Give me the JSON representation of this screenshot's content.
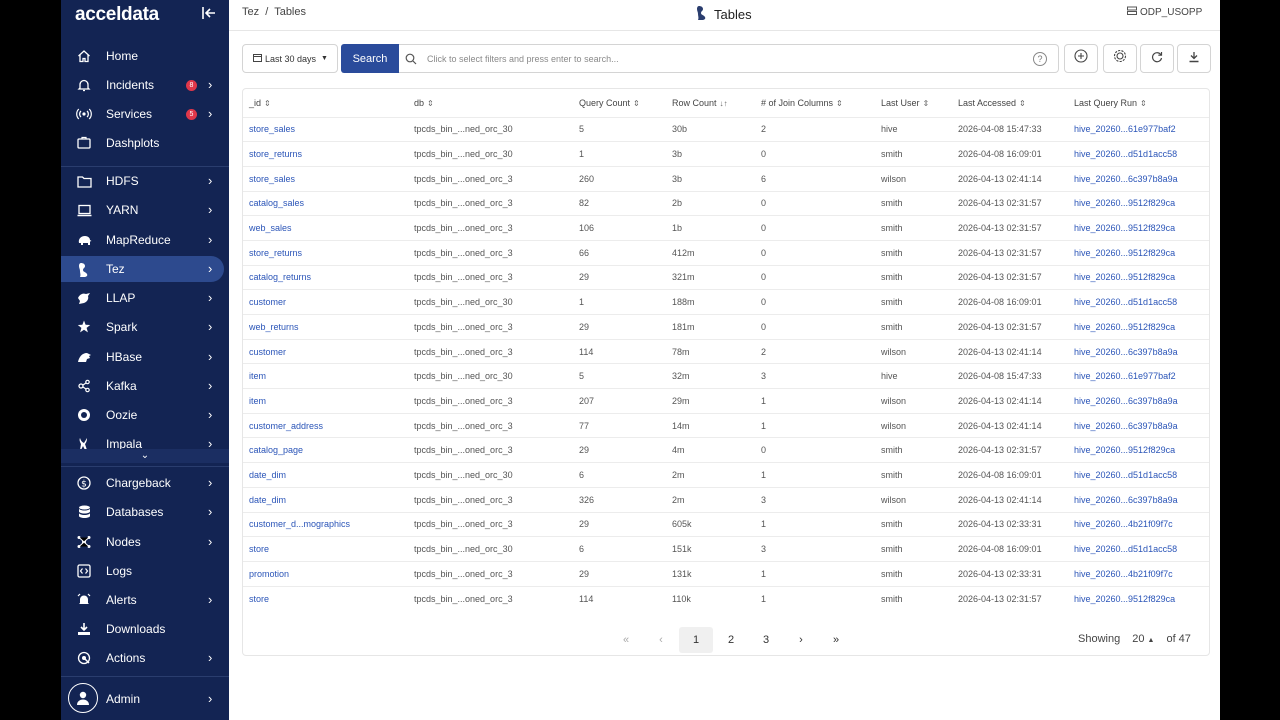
{
  "app": {
    "logo": "acceldata",
    "collapse_icon": "collapse-left-icon"
  },
  "sidebar": {
    "items": [
      {
        "label": "Home",
        "icon": "home-icon",
        "chevron": false
      },
      {
        "label": "Incidents",
        "icon": "bell-icon",
        "chevron": true,
        "badge": "8"
      },
      {
        "label": "Services",
        "icon": "broadcast-icon",
        "chevron": true,
        "badge": "5"
      },
      {
        "label": "Dashplots",
        "icon": "dashboard-icon",
        "chevron": false
      },
      {
        "label": "HDFS",
        "icon": "folder-icon",
        "chevron": true
      },
      {
        "label": "YARN",
        "icon": "laptop-icon",
        "chevron": true
      },
      {
        "label": "MapReduce",
        "icon": "elephant-icon",
        "chevron": true
      },
      {
        "label": "Tez",
        "icon": "tez-icon",
        "chevron": true,
        "active": true
      },
      {
        "label": "LLAP",
        "icon": "llap-icon",
        "chevron": true
      },
      {
        "label": "Spark",
        "icon": "spark-icon",
        "chevron": true
      },
      {
        "label": "HBase",
        "icon": "hbase-icon",
        "chevron": true
      },
      {
        "label": "Kafka",
        "icon": "kafka-icon",
        "chevron": true
      },
      {
        "label": "Oozie",
        "icon": "oozie-icon",
        "chevron": true
      },
      {
        "label": "Impala",
        "icon": "impala-icon",
        "chevron": true
      },
      {
        "label": "Chargeback",
        "icon": "dollar-icon",
        "chevron": true
      },
      {
        "label": "Databases",
        "icon": "database-icon",
        "chevron": true
      },
      {
        "label": "Nodes",
        "icon": "nodes-icon",
        "chevron": true
      },
      {
        "label": "Logs",
        "icon": "code-icon",
        "chevron": false
      },
      {
        "label": "Alerts",
        "icon": "alarm-icon",
        "chevron": true
      },
      {
        "label": "Downloads",
        "icon": "download-icon",
        "chevron": false
      },
      {
        "label": "Actions",
        "icon": "target-icon",
        "chevron": true
      }
    ],
    "scroll_more_icon": "chevron-down-icon",
    "user": {
      "label": "Admin",
      "icon": "user-icon"
    }
  },
  "header": {
    "breadcrumb": "Tez  /  Tables",
    "title": "Tables",
    "cluster": "ODP_USOPP"
  },
  "toolbar": {
    "date_range": "Last 30 days",
    "search_label": "Search",
    "search_placeholder": "Click to select filters and press enter to search..."
  },
  "table": {
    "columns": [
      "_id",
      "db",
      "Query Count",
      "Row Count",
      "# of Join Columns",
      "Last User",
      "Last Accessed",
      "Last Query Run"
    ],
    "rows": [
      [
        "store_sales",
        "tpcds_bin_...ned_orc_30",
        "5",
        "30b",
        "2",
        "hive",
        "2026-04-08 15:47:33",
        "hive_20260...61e977baf2"
      ],
      [
        "store_returns",
        "tpcds_bin_...ned_orc_30",
        "1",
        "3b",
        "0",
        "smith",
        "2026-04-08 16:09:01",
        "hive_20260...d51d1acc58"
      ],
      [
        "store_sales",
        "tpcds_bin_...oned_orc_3",
        "260",
        "3b",
        "6",
        "wilson",
        "2026-04-13 02:41:14",
        "hive_20260...6c397b8a9a"
      ],
      [
        "catalog_sales",
        "tpcds_bin_...oned_orc_3",
        "82",
        "2b",
        "0",
        "smith",
        "2026-04-13 02:31:57",
        "hive_20260...9512f829ca"
      ],
      [
        "web_sales",
        "tpcds_bin_...oned_orc_3",
        "106",
        "1b",
        "0",
        "smith",
        "2026-04-13 02:31:57",
        "hive_20260...9512f829ca"
      ],
      [
        "store_returns",
        "tpcds_bin_...oned_orc_3",
        "66",
        "412m",
        "0",
        "smith",
        "2026-04-13 02:31:57",
        "hive_20260...9512f829ca"
      ],
      [
        "catalog_returns",
        "tpcds_bin_...oned_orc_3",
        "29",
        "321m",
        "0",
        "smith",
        "2026-04-13 02:31:57",
        "hive_20260...9512f829ca"
      ],
      [
        "customer",
        "tpcds_bin_...ned_orc_30",
        "1",
        "188m",
        "0",
        "smith",
        "2026-04-08 16:09:01",
        "hive_20260...d51d1acc58"
      ],
      [
        "web_returns",
        "tpcds_bin_...oned_orc_3",
        "29",
        "181m",
        "0",
        "smith",
        "2026-04-13 02:31:57",
        "hive_20260...9512f829ca"
      ],
      [
        "customer",
        "tpcds_bin_...oned_orc_3",
        "114",
        "78m",
        "2",
        "wilson",
        "2026-04-13 02:41:14",
        "hive_20260...6c397b8a9a"
      ],
      [
        "item",
        "tpcds_bin_...ned_orc_30",
        "5",
        "32m",
        "3",
        "hive",
        "2026-04-08 15:47:33",
        "hive_20260...61e977baf2"
      ],
      [
        "item",
        "tpcds_bin_...oned_orc_3",
        "207",
        "29m",
        "1",
        "wilson",
        "2026-04-13 02:41:14",
        "hive_20260...6c397b8a9a"
      ],
      [
        "customer_address",
        "tpcds_bin_...oned_orc_3",
        "77",
        "14m",
        "1",
        "wilson",
        "2026-04-13 02:41:14",
        "hive_20260...6c397b8a9a"
      ],
      [
        "catalog_page",
        "tpcds_bin_...oned_orc_3",
        "29",
        "4m",
        "0",
        "smith",
        "2026-04-13 02:31:57",
        "hive_20260...9512f829ca"
      ],
      [
        "date_dim",
        "tpcds_bin_...ned_orc_30",
        "6",
        "2m",
        "1",
        "smith",
        "2026-04-08 16:09:01",
        "hive_20260...d51d1acc58"
      ],
      [
        "date_dim",
        "tpcds_bin_...oned_orc_3",
        "326",
        "2m",
        "3",
        "wilson",
        "2026-04-13 02:41:14",
        "hive_20260...6c397b8a9a"
      ],
      [
        "customer_d...mographics",
        "tpcds_bin_...oned_orc_3",
        "29",
        "605k",
        "1",
        "smith",
        "2026-04-13 02:33:31",
        "hive_20260...4b21f09f7c"
      ],
      [
        "store",
        "tpcds_bin_...ned_orc_30",
        "6",
        "151k",
        "3",
        "smith",
        "2026-04-08 16:09:01",
        "hive_20260...d51d1acc58"
      ],
      [
        "promotion",
        "tpcds_bin_...oned_orc_3",
        "29",
        "131k",
        "1",
        "smith",
        "2026-04-13 02:33:31",
        "hive_20260...4b21f09f7c"
      ],
      [
        "store",
        "tpcds_bin_...oned_orc_3",
        "114",
        "110k",
        "1",
        "smith",
        "2026-04-13 02:31:57",
        "hive_20260...9512f829ca"
      ]
    ]
  },
  "pagination": {
    "first": "«",
    "prev": "‹",
    "pages": [
      "1",
      "2",
      "3"
    ],
    "current": "1",
    "next": "›",
    "last": "»",
    "showing_label": "Showing",
    "page_size": "20",
    "total": "of 47"
  },
  "colors": {
    "sidebar_bg": "#132453",
    "active_item": "#2d4a8e",
    "primary": "#2a4b9b",
    "link": "#2b55b8",
    "badge": "#e0374a"
  }
}
